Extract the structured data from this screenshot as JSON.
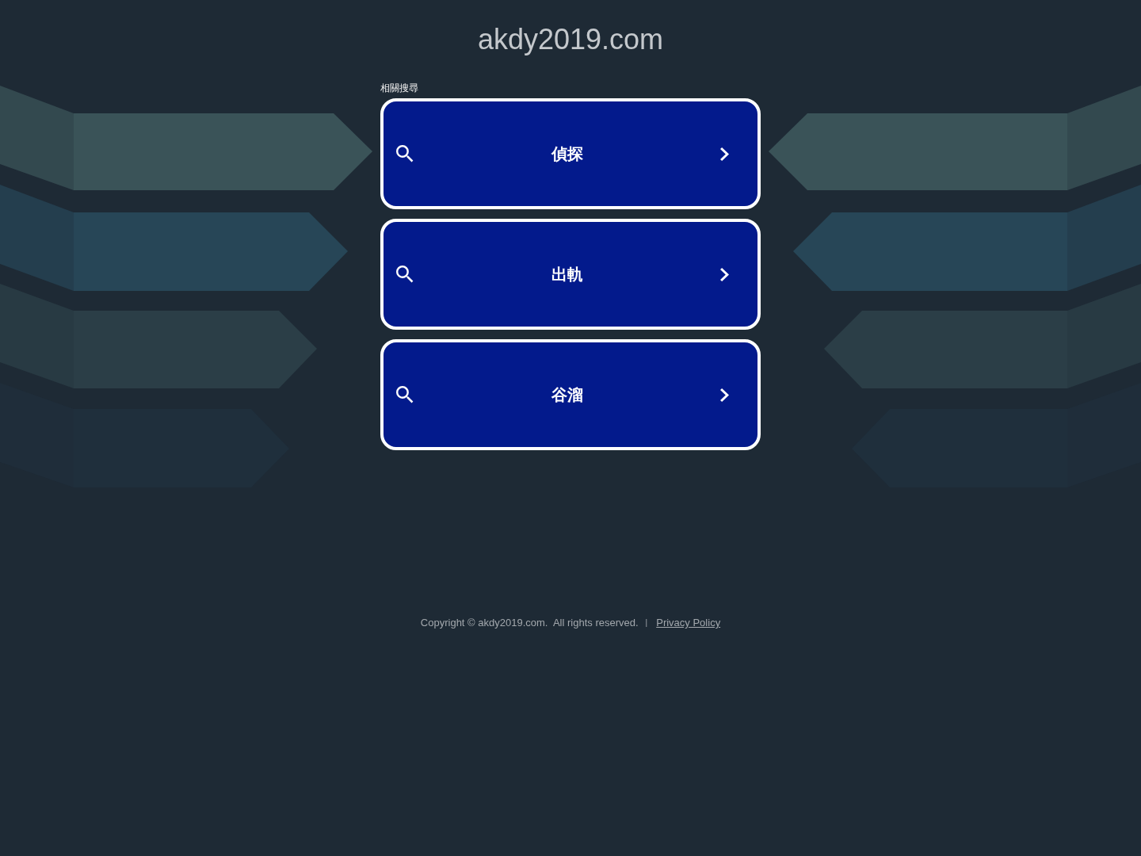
{
  "site_title": "akdy2019.com",
  "related_searches": {
    "heading": "相關搜尋",
    "items": [
      {
        "label": "偵探"
      },
      {
        "label": "出軌"
      },
      {
        "label": "谷溜"
      }
    ]
  },
  "footer": {
    "copyright": "Copyright © akdy2019.com.  All rights reserved.",
    "separator": "|",
    "privacy_link": "Privacy Policy"
  }
}
